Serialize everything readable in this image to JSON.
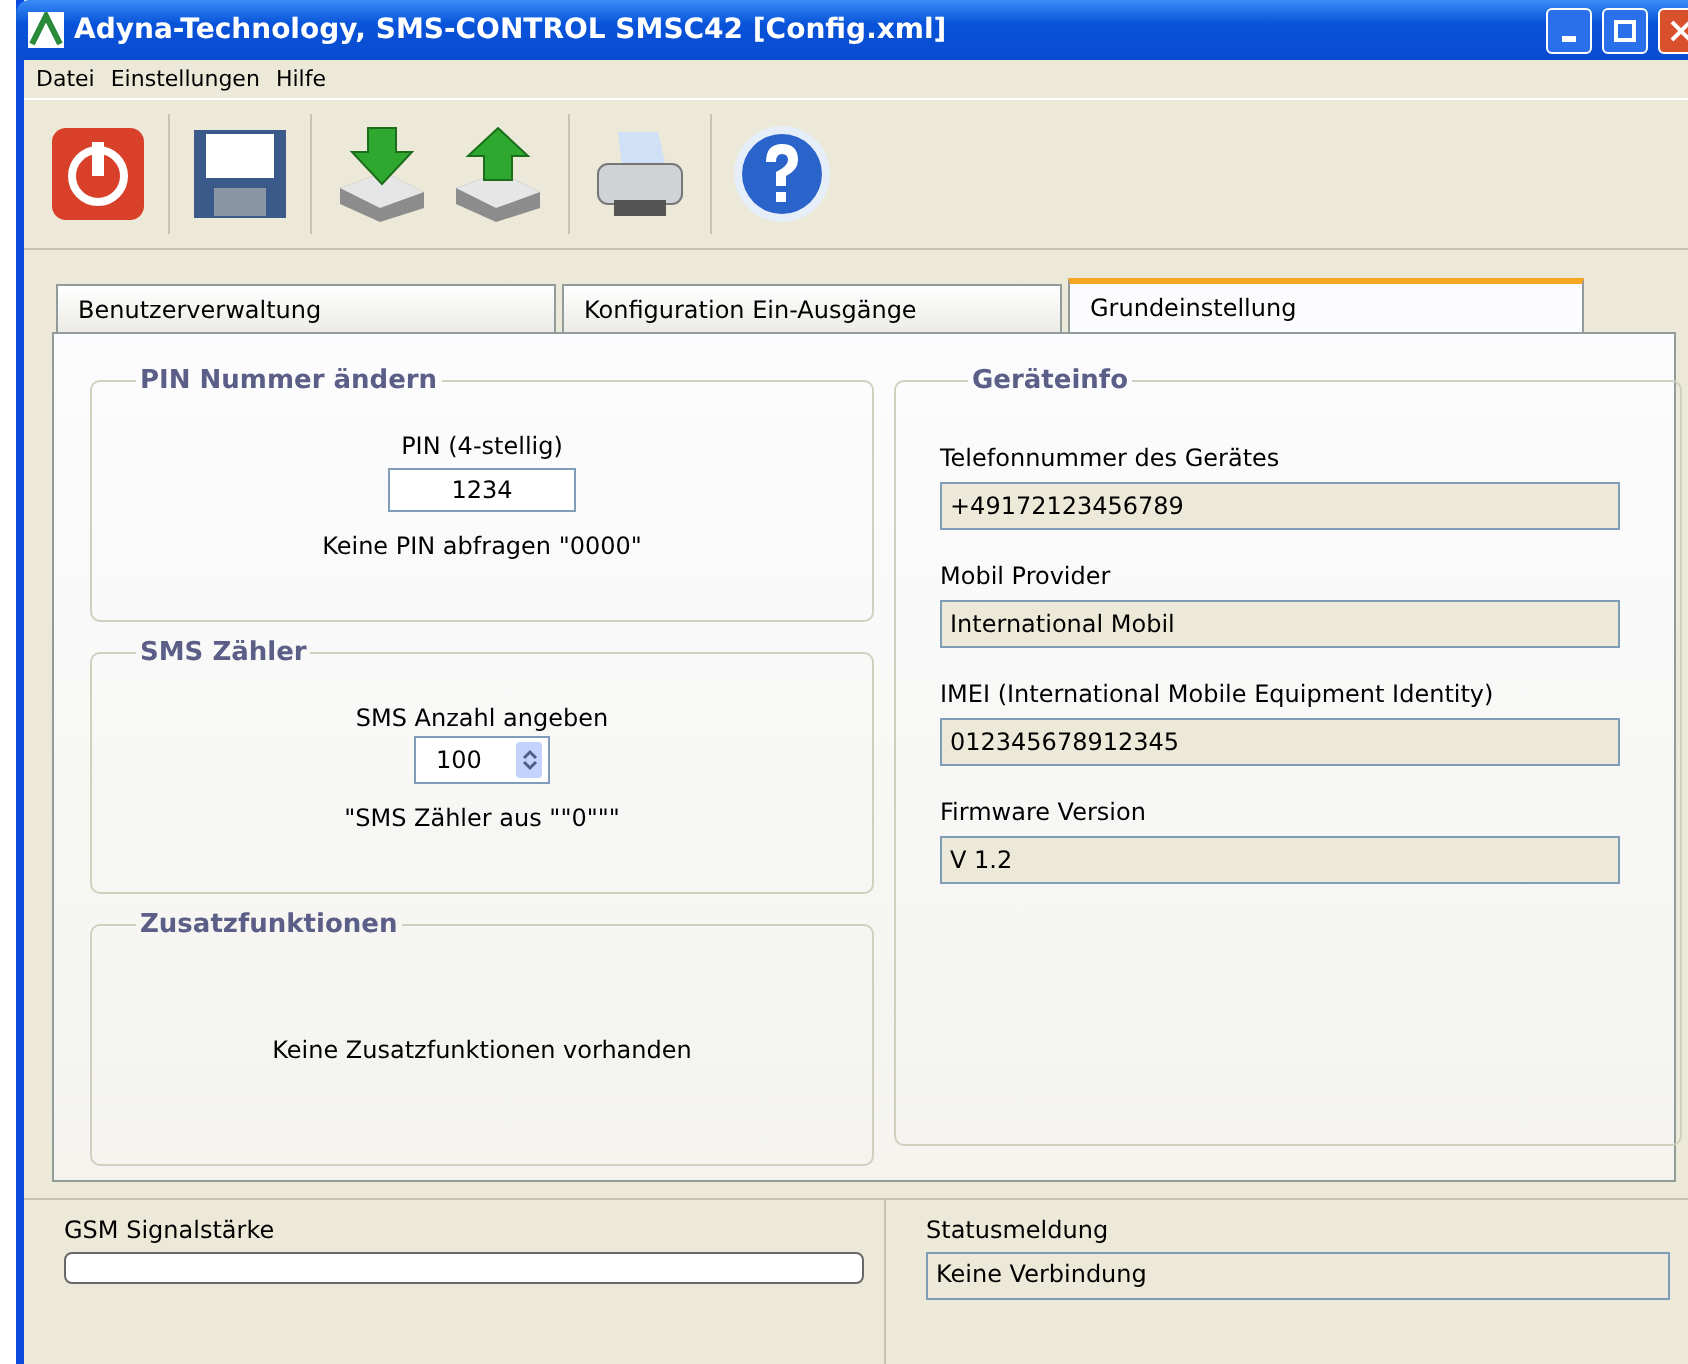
{
  "window": {
    "title": "Adyna-Technology, SMS-CONTROL SMSC42 [Config.xml]"
  },
  "menu": [
    "Datei",
    "Einstellungen",
    "Hilfe"
  ],
  "toolbar": [
    {
      "kind": "power"
    },
    {
      "kind": "save"
    },
    {
      "kind": "download"
    },
    {
      "kind": "upload"
    },
    {
      "kind": "print"
    },
    {
      "kind": "help"
    }
  ],
  "tabs": [
    {
      "label": "Benutzerverwaltung",
      "selected": false
    },
    {
      "label": "Konfiguration Ein-Ausgänge",
      "selected": false
    },
    {
      "label": "Grundeinstellung",
      "selected": true
    }
  ],
  "pin": {
    "title": "PIN Nummer ändern",
    "label": "PIN (4-stellig)",
    "value": "1234",
    "hint": "Keine PIN abfragen \"0000\""
  },
  "sms": {
    "title": "SMS Zähler",
    "label": "SMS Anzahl angeben",
    "value": "100",
    "hint": "\"SMS Zähler aus \"\"0\"\"\""
  },
  "extras": {
    "title": "Zusatzfunktionen",
    "text": "Keine Zusatzfunktionen vorhanden"
  },
  "device_info": {
    "title": "Geräteinfo",
    "fields": [
      {
        "label": "Telefonnummer des Gerätes",
        "value": "+49172123456789"
      },
      {
        "label": "Mobil Provider",
        "value": "International Mobil"
      },
      {
        "label": "IMEI (International Mobile Equipment Identity)",
        "value": "012345678912345"
      },
      {
        "label": "Firmware Version",
        "value": "V 1.2"
      }
    ]
  },
  "status_bar": {
    "signal_label": "GSM Signalstärke",
    "signal": {
      "level": 0
    },
    "status_label": "Statusmeldung",
    "status": "Keine Verbindung"
  }
}
